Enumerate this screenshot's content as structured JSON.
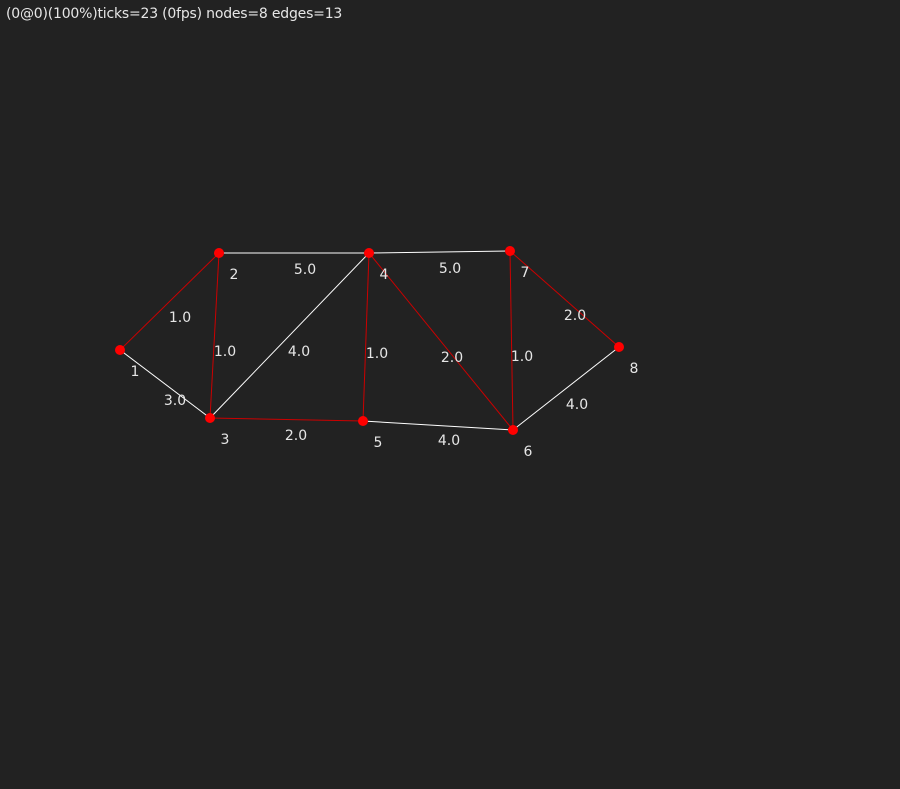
{
  "status": {
    "text": "(0@0)(100%)ticks=23 (0fps) nodes=8 edges=13"
  },
  "colors": {
    "background": "#222222",
    "node": "#ff0000",
    "edge_default": "#ffffff",
    "edge_highlight": "#cc0000",
    "label": "#e6e6e6"
  },
  "graph": {
    "nodes": [
      {
        "id": "1",
        "label": "1"
      },
      {
        "id": "2",
        "label": "2"
      },
      {
        "id": "3",
        "label": "3"
      },
      {
        "id": "4",
        "label": "4"
      },
      {
        "id": "5",
        "label": "5"
      },
      {
        "id": "6",
        "label": "6"
      },
      {
        "id": "7",
        "label": "7"
      },
      {
        "id": "8",
        "label": "8"
      }
    ],
    "edges": [
      {
        "from": "1",
        "to": "2",
        "weight": "1.0",
        "highlight": true
      },
      {
        "from": "1",
        "to": "3",
        "weight": "3.0",
        "highlight": false
      },
      {
        "from": "2",
        "to": "3",
        "weight": "1.0",
        "highlight": true
      },
      {
        "from": "2",
        "to": "4",
        "weight": "5.0",
        "highlight": false
      },
      {
        "from": "3",
        "to": "4",
        "weight": "4.0",
        "highlight": false
      },
      {
        "from": "3",
        "to": "5",
        "weight": "2.0",
        "highlight": true
      },
      {
        "from": "4",
        "to": "5",
        "weight": "1.0",
        "highlight": true
      },
      {
        "from": "4",
        "to": "6",
        "weight": "2.0",
        "highlight": true
      },
      {
        "from": "4",
        "to": "7",
        "weight": "5.0",
        "highlight": false
      },
      {
        "from": "5",
        "to": "6",
        "weight": "4.0",
        "highlight": false
      },
      {
        "from": "6",
        "to": "7",
        "weight": "1.0",
        "highlight": true
      },
      {
        "from": "6",
        "to": "8",
        "weight": "4.0",
        "highlight": false
      },
      {
        "from": "7",
        "to": "8",
        "weight": "2.0",
        "highlight": true
      }
    ]
  }
}
